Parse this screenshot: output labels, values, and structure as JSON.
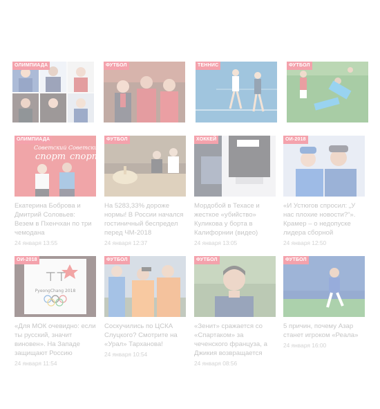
{
  "row1": [
    {
      "tag": "ОЛИМПИАДА"
    },
    {
      "tag": "ФУТБОЛ"
    },
    {
      "tag": "ТЕННИС"
    },
    {
      "tag": "ФУТБОЛ"
    }
  ],
  "row2": [
    {
      "tag": "ОЛИМПИАДА",
      "title": "Екатерина Боброва и Дмитрий Соловьев: Везем в Пхенчхан по три чемодана",
      "date": "24 января 13:55",
      "img_text_1": "Советский",
      "img_text_2": "спорт"
    },
    {
      "tag": "ФУТБОЛ",
      "title": "На 5283,33% дороже нормы! В России начался гостиничный беспредел перед ЧМ-2018",
      "date": "24 января 12:37"
    },
    {
      "tag": "ХОККЕЙ",
      "title": "Мордобой в Техасе и жесткое «убийство» Куликова у борта в Калифорнии (видео)",
      "date": "24 января 13:05"
    },
    {
      "tag": "ОИ-2018",
      "title": "«И Устюгов спросил: „У нас плохие новости?“». Крамер – о недопуске лидера сборной",
      "date": "24 января 12:50"
    }
  ],
  "row3": [
    {
      "tag": "ОИ-2018",
      "title": "«Для МОК очевидно: если ты русский, значит виновен». На Западе защищают Россию",
      "date": "24 января 11:54",
      "img_text": "PyeongChang 2018"
    },
    {
      "tag": "ФУТБОЛ",
      "title": "Соскучились по ЦСКА Слуцкого? Смотрите на «Урал» Тарханова!",
      "date": "24 января 10:54"
    },
    {
      "tag": "ФУТБОЛ",
      "title": "«Зенит» сражается со «Спартаком» за чеченского француза, а Джикия возвращается",
      "date": "24 января 08:56"
    },
    {
      "tag": "ФУТБОЛ",
      "title": "5 причин, почему Азар станет игроком «Реала»",
      "date": "24 января 16:00"
    }
  ]
}
